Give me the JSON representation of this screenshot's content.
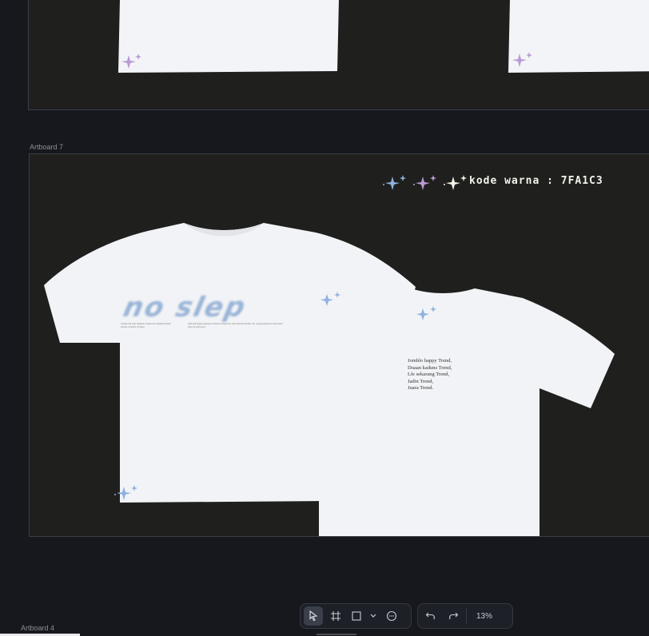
{
  "artboards": [
    {
      "name": ""
    },
    {
      "name": "Artboard 7"
    },
    {
      "name": "Artboard 4"
    }
  ],
  "design": {
    "color_code": "kode warna : 7FA1C3",
    "front_graphic": "no slep",
    "back_text": [
      "Jomblo happy Trend,",
      "Duaan kaduns Trend,",
      "Lfe sekarang Trend,",
      "Jadin Trend,",
      "Juara Trend."
    ],
    "front_caption_left": "Tanaga mu bayi maganto tangan ku setumpuk hitam selesai, terdaftar di tanya",
    "front_caption_right": "kaki jadi bagus panjang di dalam si kayu kau akan diterima ketika ada orang panjang di tanya akan lulus di jalan jawa",
    "brand_color": "#7FA1C3",
    "sparkle_colors": [
      "#8FB2E0",
      "#B99BD6",
      "#F5F2E6"
    ]
  },
  "toolbar": {
    "tools": [
      {
        "icon": "pointer-icon",
        "active": true
      },
      {
        "icon": "frame-icon",
        "active": false
      },
      {
        "icon": "rectangle-icon",
        "active": false
      },
      {
        "icon": "chevron-down-icon",
        "active": false
      },
      {
        "icon": "comment-icon",
        "active": false
      }
    ],
    "history": [
      {
        "icon": "undo-icon"
      },
      {
        "icon": "redo-icon"
      }
    ],
    "zoom": "13%"
  }
}
